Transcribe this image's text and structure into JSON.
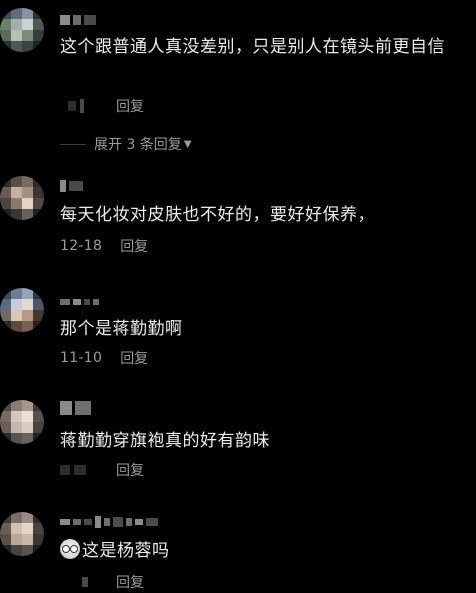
{
  "comments": [
    {
      "text": "这个跟普通人真没差别，只是别人在镜头前更自信",
      "date": "",
      "reply_label": "回复",
      "expand_label": "展开 3 条回复"
    },
    {
      "text": "每天化妆对皮肤也不好的，要好好保养，",
      "date": "12-18",
      "reply_label": "回复"
    },
    {
      "text": "那个是蒋勤勤啊",
      "date": "11-10",
      "reply_label": "回复"
    },
    {
      "text": "蒋勤勤穿旗袍真的好有韵味",
      "date": "",
      "reply_label": "回复"
    },
    {
      "text": "这是杨蓉吗",
      "emoji": "staring-eyes-emoji",
      "date": "",
      "reply_label": "回复"
    }
  ],
  "colors": {
    "background": "#000000",
    "text_primary": "#ececec",
    "text_secondary": "#9a9a9a"
  }
}
